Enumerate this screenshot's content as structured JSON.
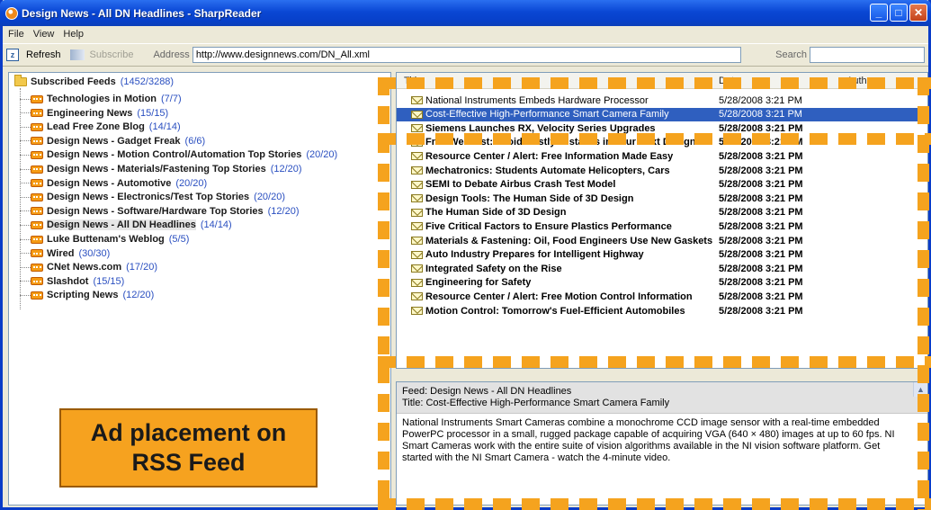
{
  "window": {
    "title": "Design News - All DN Headlines - SharpReader",
    "buttons": {
      "minimize": "_",
      "maximize": "□",
      "close": "✕"
    }
  },
  "menu": [
    "File",
    "View",
    "Help"
  ],
  "toolbar": {
    "refresh_label": "Refresh",
    "subscribe_label": "Subscribe",
    "address_label": "Address",
    "address_value": "http://www.designnews.com/DN_All.xml",
    "search_label": "Search"
  },
  "tree": {
    "root": {
      "label": "Subscribed Feeds",
      "count": "(1452/3288)"
    },
    "items": [
      {
        "label": "Technologies in Motion",
        "count": "(7/7)"
      },
      {
        "label": "Engineering News",
        "count": "(15/15)"
      },
      {
        "label": "Lead Free Zone Blog",
        "count": "(14/14)"
      },
      {
        "label": "Design News - Gadget Freak",
        "count": "(6/6)"
      },
      {
        "label": "Design News - Motion Control/Automation Top Stories",
        "count": "(20/20)"
      },
      {
        "label": "Design News - Materials/Fastening Top Stories",
        "count": "(12/20)"
      },
      {
        "label": "Design News - Automotive",
        "count": "(20/20)"
      },
      {
        "label": "Design News - Electronics/Test Top Stories",
        "count": "(20/20)"
      },
      {
        "label": "Design News - Software/Hardware Top Stories",
        "count": "(12/20)"
      },
      {
        "label": "Design News - All DN Headlines",
        "count": "(14/14)",
        "selected": true
      },
      {
        "label": "Luke Buttenam's Weblog",
        "count": "(5/5)"
      },
      {
        "label": "Wired",
        "count": "(30/30)"
      },
      {
        "label": "CNet News.com",
        "count": "(17/20)"
      },
      {
        "label": "Slashdot",
        "count": "(15/15)"
      },
      {
        "label": "Scripting News",
        "count": "(12/20)"
      }
    ]
  },
  "ad": {
    "line1": "Ad placement on",
    "line2": "RSS Feed"
  },
  "list": {
    "headers": {
      "title": "Title",
      "date": "Date",
      "author": "Author"
    },
    "rows": [
      {
        "title": "National Instruments Embeds Hardware Processor",
        "date": "5/28/2008 3:21 PM",
        "read": true
      },
      {
        "title": "Cost-Effective High-Performance Smart Camera Family",
        "date": "5/28/2008 3:21 PM",
        "selected": true,
        "read": true
      },
      {
        "title": "Siemens Launches RX, Velocity Series Upgrades",
        "date": "5/28/2008 3:21 PM"
      },
      {
        "title": "Free Webcast: Avoid Costly Mistakes in Your Next Design",
        "date": "5/28/2008 3:21 PM"
      },
      {
        "title": "Resource Center / Alert: Free Information Made Easy",
        "date": "5/28/2008 3:21 PM"
      },
      {
        "title": "Mechatronics: Students Automate Helicopters, Cars",
        "date": "5/28/2008 3:21 PM"
      },
      {
        "title": "SEMI to Debate Airbus Crash Test Model",
        "date": "5/28/2008 3:21 PM"
      },
      {
        "title": "Design Tools: The Human Side of 3D Design",
        "date": "5/28/2008 3:21 PM"
      },
      {
        "title": "The Human Side of 3D Design",
        "date": "5/28/2008 3:21 PM"
      },
      {
        "title": "Five Critical Factors to Ensure Plastics Performance",
        "date": "5/28/2008 3:21 PM"
      },
      {
        "title": "Materials & Fastening: Oil, Food Engineers Use New Gaskets",
        "date": "5/28/2008 3:21 PM"
      },
      {
        "title": "Auto Industry Prepares for Intelligent Highway",
        "date": "5/28/2008 3:21 PM"
      },
      {
        "title": "Integrated Safety on the Rise",
        "date": "5/28/2008 3:21 PM"
      },
      {
        "title": "Engineering for Safety",
        "date": "5/28/2008 3:21 PM"
      },
      {
        "title": "Resource Center / Alert: Free Motion Control Information",
        "date": "5/28/2008 3:21 PM"
      },
      {
        "title": "Motion Control: Tomorrow's Fuel-Efficient Automobiles",
        "date": "5/28/2008 3:21 PM"
      }
    ]
  },
  "preview": {
    "feed_line": "Feed: Design News - All DN Headlines",
    "title_line": "Title: Cost-Effective High-Performance Smart Camera Family",
    "body": "National Instruments Smart Cameras combine a monochrome CCD image sensor with a real-time embedded PowerPC processor in a small, rugged package capable of acquiring VGA (640 × 480) images at up to 60 fps. NI Smart Cameras work with the entire suite of vision algorithms available in the NI vision software platform. Get started with the NI Smart Camera - watch the 4-minute video."
  },
  "colors": {
    "titlebar": "#0a47d4",
    "accent_orange": "#f5a31e",
    "selection": "#2f5fbf"
  }
}
